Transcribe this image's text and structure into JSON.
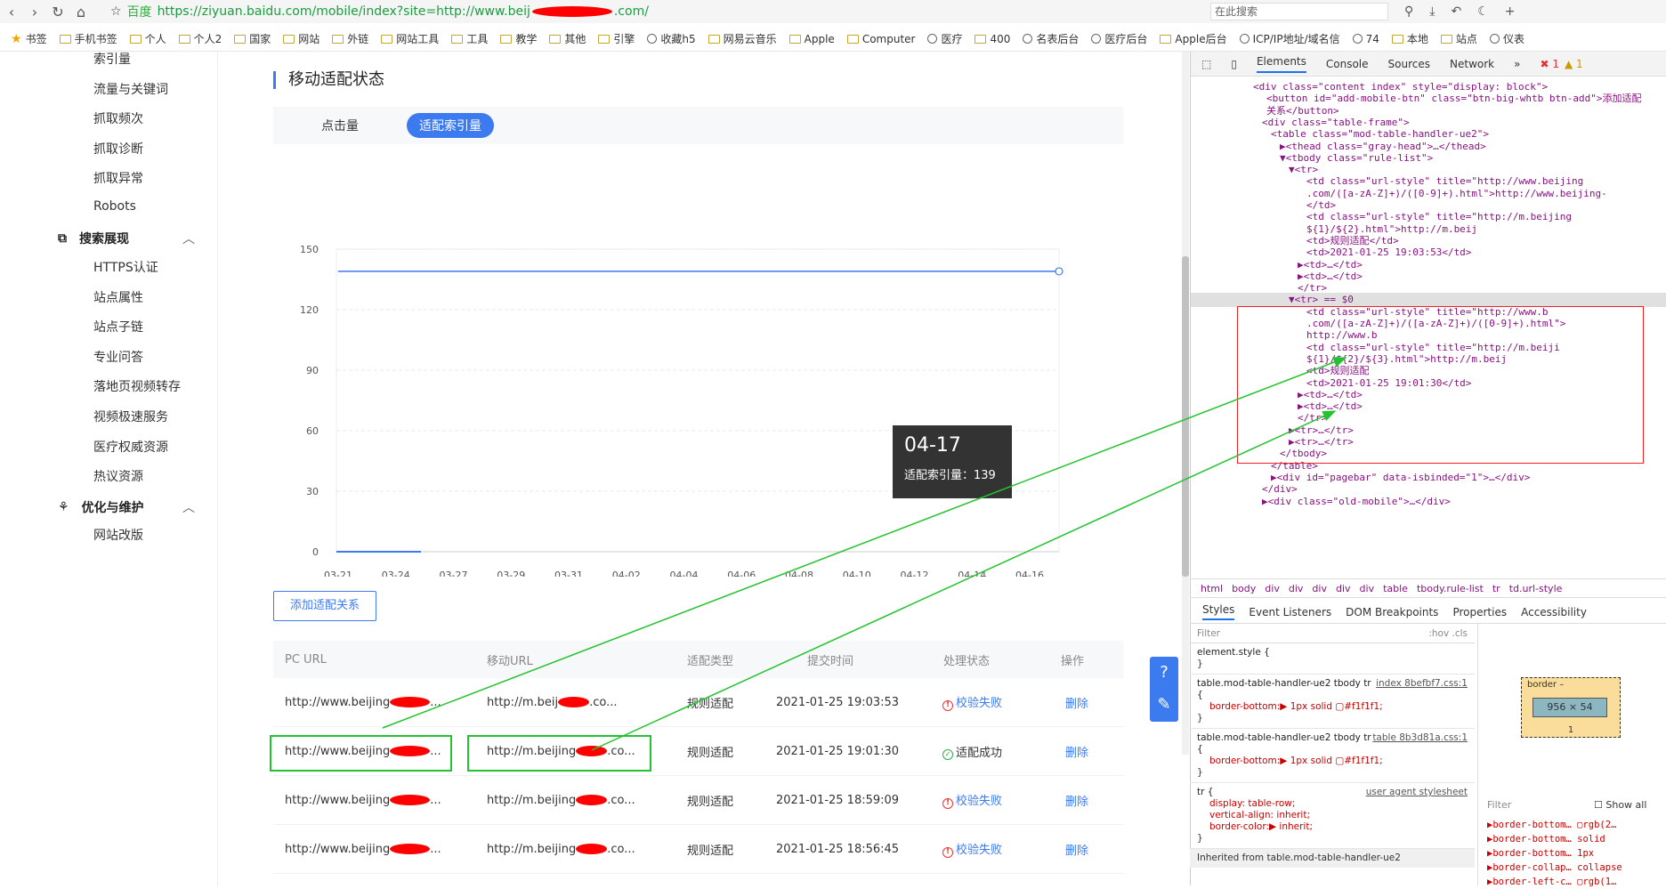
{
  "browser": {
    "back": "‹",
    "forward": "›",
    "reload": "↻",
    "home": "⌂",
    "bookmark_star": "☆",
    "site_name": "百度",
    "url": "https://ziyuan.baidu.com/mobile/index?site=http://www.beij",
    "url_tail": ".com/",
    "search_placeholder": "在此搜索"
  },
  "bookmarks": [
    "书签",
    "手机书签",
    "个人",
    "个人2",
    "国家",
    "网站",
    "外链",
    "网站工具",
    "工具",
    "教学",
    "其他",
    "引擎",
    "收藏h5",
    "网易云音乐",
    "Apple",
    "Computer",
    "医疗",
    "400",
    "名表后台",
    "医疗后台",
    "Apple后台",
    "ICP/IP地址/域名信",
    "74",
    "本地",
    "站点",
    "仪表"
  ],
  "sidebar": {
    "items_top": [
      "索引量",
      "流量与关键词",
      "抓取频次",
      "抓取诊断",
      "抓取异常",
      "Robots"
    ],
    "group1": "搜索展现",
    "group1_items": [
      "HTTPS认证",
      "站点属性",
      "站点子链",
      "专业问答",
      "落地页视频转存",
      "视频极速服务",
      "医疗权威资源",
      "热议资源"
    ],
    "group2": "优化与维护",
    "group2_items": [
      "网站改版"
    ]
  },
  "main": {
    "title": "移动适配状态",
    "tabs": [
      "点击量",
      "适配索引量"
    ],
    "add_button": "添加适配关系"
  },
  "tooltip": {
    "date": "04-17",
    "label": "适配索引量：139"
  },
  "chart_data": {
    "type": "line",
    "categories": [
      "03-21",
      "03-24",
      "03-27",
      "03-29",
      "03-31",
      "04-02",
      "04-04",
      "04-06",
      "04-08",
      "04-10",
      "04-12",
      "04-14",
      "04-16"
    ],
    "series": [
      {
        "values": [
          139,
          139,
          139,
          139,
          139,
          139,
          139,
          139,
          139,
          139,
          139,
          139,
          139
        ]
      }
    ],
    "yticks": [
      0,
      30,
      60,
      90,
      120,
      150
    ],
    "ylim": [
      0,
      150
    ],
    "color": "#3c7af0"
  },
  "table": {
    "headers": [
      "PC URL",
      "移动URL",
      "适配类型",
      "提交时间",
      "处理状态",
      "操作"
    ],
    "rows": [
      {
        "pc": "http://www.beijing",
        "mobile": "http://m.beij",
        "mobile_tail": ".co...",
        "type": "规则适配",
        "time": "2021-01-25 19:03:53",
        "status": "校验失败",
        "status_kind": "fail",
        "action": "删除"
      },
      {
        "pc": "http://www.beijing",
        "mobile": "http://m.beijing",
        "mobile_tail": ".co...",
        "type": "规则适配",
        "time": "2021-01-25 19:01:30",
        "status": "适配成功",
        "status_kind": "ok",
        "action": "删除"
      },
      {
        "pc": "http://www.beijing",
        "mobile": "http://m.beijing",
        "mobile_tail": ".co...",
        "type": "规则适配",
        "time": "2021-01-25 18:59:09",
        "status": "校验失败",
        "status_kind": "fail",
        "action": "删除"
      },
      {
        "pc": "http://www.beijing",
        "mobile": "http://m.beijing",
        "mobile_tail": ".co...",
        "type": "规则适配",
        "time": "2021-01-25 18:56:45",
        "status": "校验失败",
        "status_kind": "fail",
        "action": "删除"
      }
    ]
  },
  "devtools": {
    "tabs": [
      "Elements",
      "Console",
      "Sources",
      "Network",
      "»"
    ],
    "errors": "1",
    "warnings": "1",
    "dom": [
      "<div class=\"content index\" style=\"display: block\">",
      "<button id=\"add-mobile-btn\" class=\"btn-big-whtb btn-add\">添加适配",
      "关系</button>",
      "<div class=\"table-frame\">",
      "<table class=\"mod-table-handler-ue2\">",
      "▶<thead class=\"gray-head\">…</thead>",
      "▼<tbody class=\"rule-list\">",
      "▼<tr>",
      "<td class=\"url-style\" title=\"http://www.beijing",
      ".com/([a-zA-Z]+)/([0-9]+).html\">http://www.beijing-",
      "</td>",
      "<td class=\"url-style\" title=\"http://m.beijing",
      "${1}/${2}.html\">http://m.beij",
      "<td>规则适配</td>",
      "<td>2021-01-25 19:03:53</td>",
      "▶<td>…</td>",
      "▶<td>…</td>",
      "</tr>",
      "▼<tr> == $0",
      "<td class=\"url-style\" title=\"http://www.b",
      ".com/([a-zA-Z]+)/([a-zA-Z]+)/([0-9]+).html\">",
      "http://www.b",
      "<td class=\"url-style\" title=\"http://m.beiji",
      "${1}/${2}/${3}.html\">http://m.beij",
      "<td>规则适配",
      "<td>2021-01-25 19:01:30</td>",
      "▶<td>…</td>",
      "▶<td>…</td>",
      "</tr>",
      "▶<tr>…</tr>",
      "▶<tr>…</tr>",
      "</tbody>",
      "</table>",
      "▶<div id=\"pagebar\" data-isbinded=\"1\">…</div>",
      "</div>",
      "▶<div class=\"old-mobile\">…</div>"
    ],
    "breadcrumbs": [
      "html",
      "body",
      "div",
      "div",
      "div",
      "div",
      "div",
      "table",
      "tbody.rule-list",
      "tr",
      "td.url-style"
    ],
    "style_tabs": [
      "Styles",
      "Event Listeners",
      "DOM Breakpoints",
      "Properties",
      "Accessibility"
    ],
    "filter": "Filter",
    "hov": ":hov .cls",
    "styles": [
      {
        "sel": "element.style {",
        "lines": [
          "}"
        ],
        "link": ""
      },
      {
        "sel": "table.mod-table-handler-ue2 tbody tr {",
        "lines": [
          "border-bottom:▶ 1px solid ▢#f1f1f1;",
          "}"
        ],
        "link": "index 8befbf7.css:1"
      },
      {
        "sel": "table.mod-table-handler-ue2 tbody tr {",
        "lines": [
          "border-bottom:▶ 1px solid ▢#f1f1f1;",
          "}"
        ],
        "link": "table 8b3d81a.css:1"
      },
      {
        "sel": "tr {",
        "lines": [
          "display: table-row;",
          "vertical-align: inherit;",
          "border-color:▶ inherit;",
          "}"
        ],
        "link": "user agent stylesheet"
      }
    ],
    "inherited": "Inherited from table.mod-table-handler-ue2",
    "boxmodel": {
      "label": "border –",
      "size": "956 × 54",
      "bottom": "1",
      "filter": "Filter",
      "show_all": "Show all",
      "props": [
        "▶border-bottom… ▢rgb(2…",
        "▶border-bottom… solid",
        "▶border-bottom… 1px",
        "▶border-collap… collapse",
        "▶border-left-c… ▢rgb(1…"
      ]
    }
  }
}
